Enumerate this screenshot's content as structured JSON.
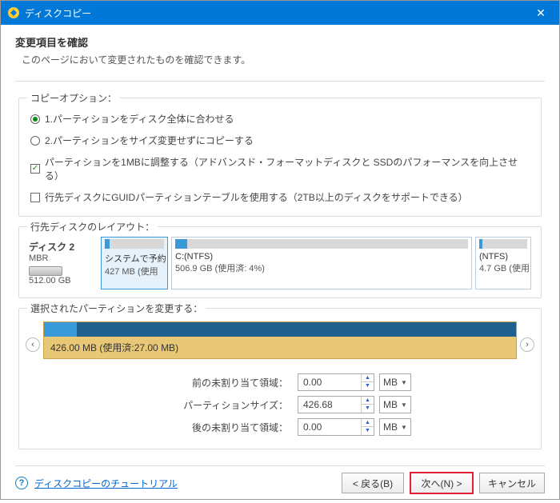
{
  "titlebar": {
    "title": "ディスクコピー"
  },
  "header": {
    "title": "変更項目を確認",
    "subtitle": "このページにおいて変更されたものを確認できます。"
  },
  "copy_options": {
    "group_title": "コピーオプション：",
    "radio1": "1.パーティションをディスク全体に合わせる",
    "radio2": "2.パーティションをサイズ変更せずにコピーする",
    "chk1": "パーティションを1MBに調整する（アドバンスド・フォーマットディスクと SSDのパフォーマンスを向上させる）",
    "chk2": "行先ディスクにGUIDパーティションテーブルを使用する（2TB以上のディスクをサポートできる）"
  },
  "dest_layout": {
    "group_title": "行先ディスクのレイアウト：",
    "disk": {
      "name": "ディスク 2",
      "type": "MBR",
      "size": "512.00 GB"
    },
    "partitions": [
      {
        "name": "システムで予約",
        "size": "427 MB (使用",
        "fill_pct": 8
      },
      {
        "name": "C:(NTFS)",
        "size": "506.9 GB (使用済: 4%)",
        "fill_pct": 4
      },
      {
        "name": "(NTFS)",
        "size": "4.7 GB (使用",
        "fill_pct": 6
      }
    ]
  },
  "edit": {
    "group_title": "選択されたパーティションを変更する：",
    "selected_info": "426.00 MB (使用済:27.00 MB)"
  },
  "fields": {
    "before_label": "前の未割り当て領域：",
    "before_val": "0.00",
    "size_label": "パーティションサイズ：",
    "size_val": "426.68",
    "after_label": "後の未割り当て領域：",
    "after_val": "0.00",
    "unit": "MB"
  },
  "footer": {
    "help": "ディスクコピーのチュートリアル",
    "back": "< 戻る(B)",
    "next": "次へ(N) >",
    "cancel": "キャンセル"
  }
}
